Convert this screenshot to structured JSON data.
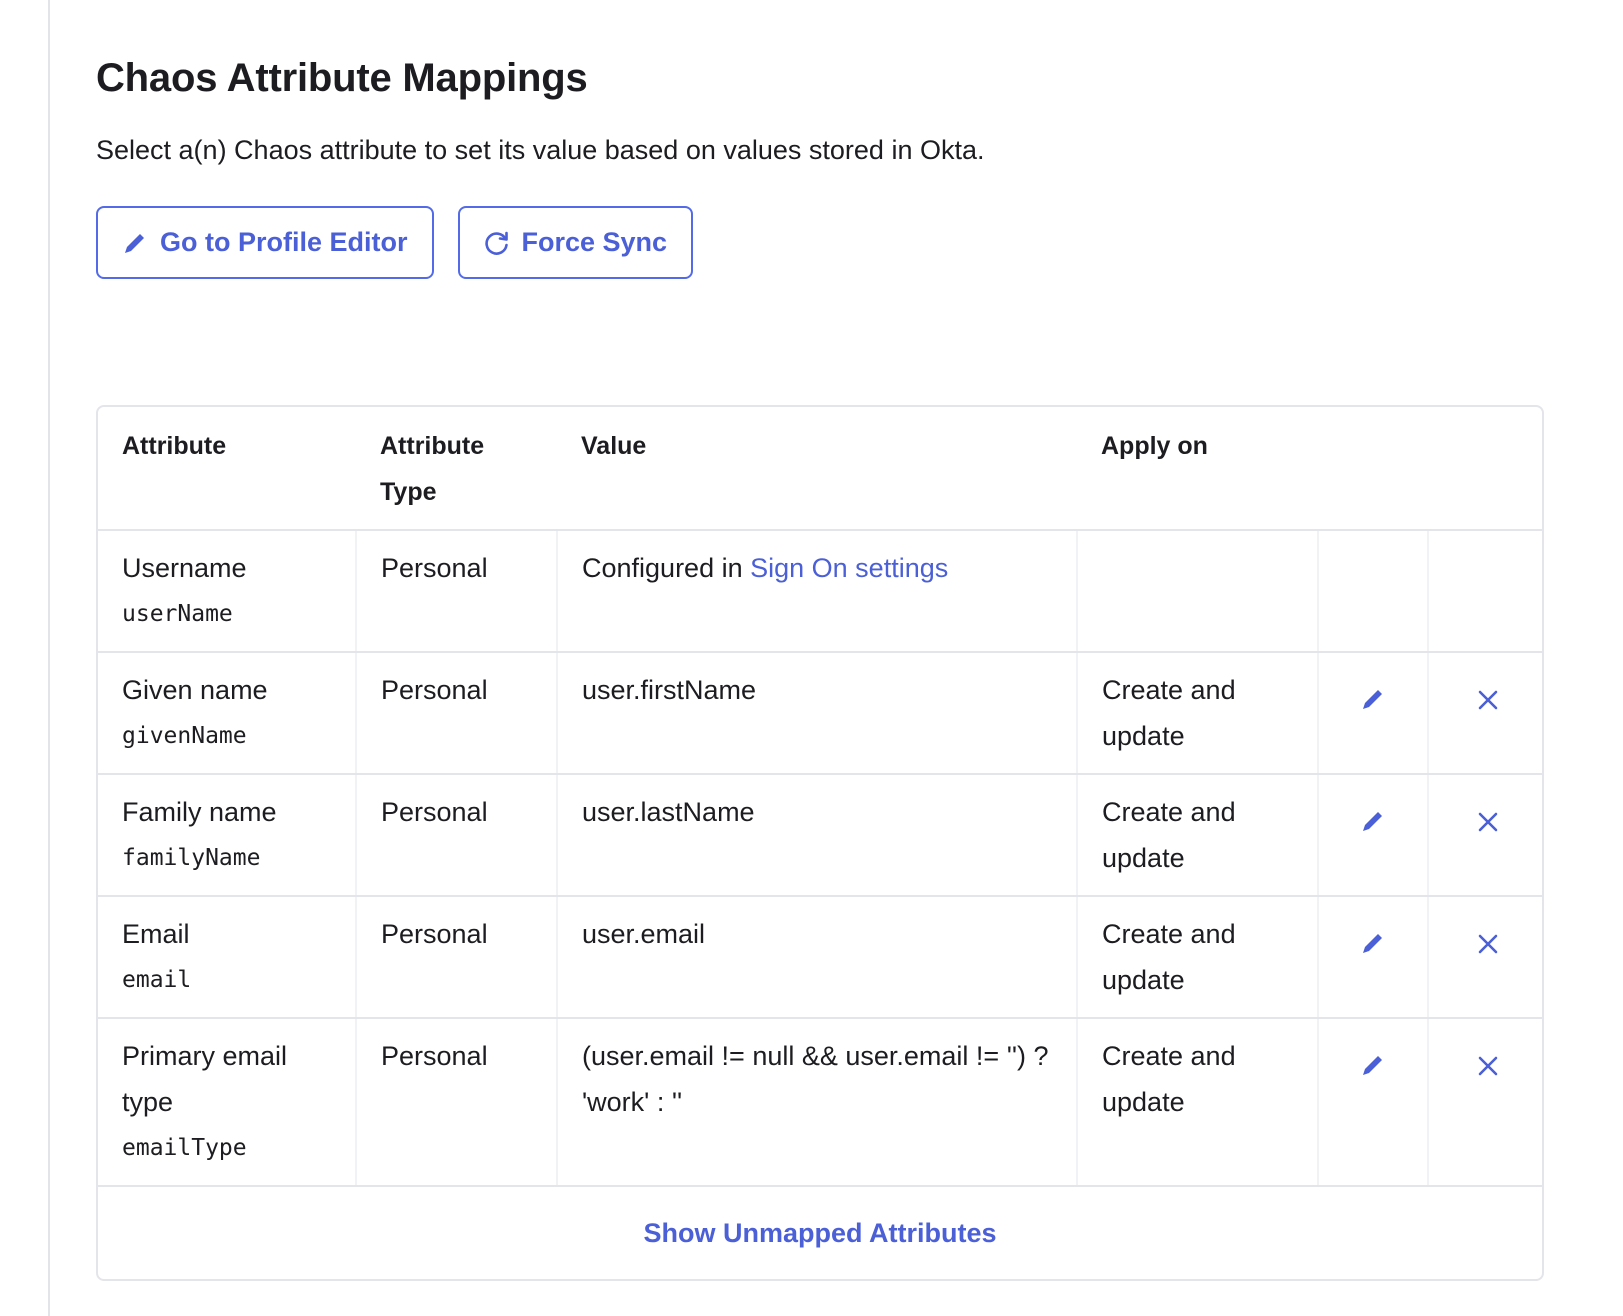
{
  "header": {
    "title": "Chaos Attribute Mappings",
    "subtitle": "Select a(n) Chaos attribute to set its value based on values stored in Okta."
  },
  "buttons": {
    "profile_editor": {
      "label": "Go to Profile Editor",
      "icon": "pencil-icon"
    },
    "force_sync": {
      "label": "Force Sync",
      "icon": "refresh-icon"
    }
  },
  "table": {
    "columns": [
      "Attribute",
      "Attribute Type",
      "Value",
      "Apply on"
    ],
    "rows": [
      {
        "name": "Username",
        "key": "userName",
        "type": "Personal",
        "value_prefix": "Configured in",
        "value_link": "Sign On settings",
        "apply_on": ""
      },
      {
        "name": "Given name",
        "key": "givenName",
        "type": "Personal",
        "value": "user.firstName",
        "apply_on": "Create and update"
      },
      {
        "name": "Family name",
        "key": "familyName",
        "type": "Personal",
        "value": "user.lastName",
        "apply_on": "Create and update"
      },
      {
        "name": "Email",
        "key": "email",
        "type": "Personal",
        "value": "user.email",
        "apply_on": "Create and update"
      },
      {
        "name": "Primary email type",
        "key": "emailType",
        "type": "Personal",
        "value": "(user.email != null && user.email != '') ? 'work' : ''",
        "apply_on": "Create and update"
      }
    ],
    "footer_link": "Show Unmapped Attributes"
  },
  "colors": {
    "accent": "#4b5fd6",
    "border": "#e4e5ea",
    "text": "#1d1d21"
  }
}
